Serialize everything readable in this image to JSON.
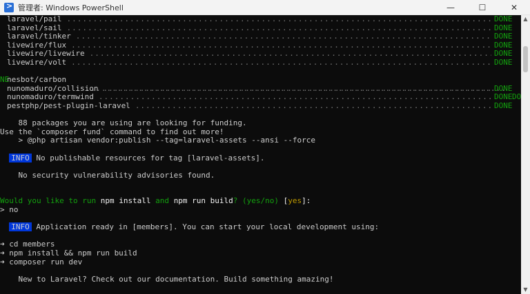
{
  "window": {
    "title": "管理者: Windows PowerShell",
    "minimize": "—",
    "maximize": "☐",
    "close": "✕"
  },
  "scrollbar": {
    "up": "▲",
    "down": "▼"
  },
  "packages": [
    {
      "name": "laravel/pail",
      "status": "DONE"
    },
    {
      "name": "laravel/sail",
      "status": "DONE"
    },
    {
      "name": "laravel/tinker",
      "status": "DONE"
    },
    {
      "name": "livewire/flux",
      "status": "DONE"
    },
    {
      "name": "livewire/livewire",
      "status": "DONE"
    },
    {
      "name": "livewire/volt",
      "status": "DONE"
    }
  ],
  "nesbot": {
    "name": "nesbot/carbon",
    "status_a": "DO",
    "status_b": "NE"
  },
  "packages2": [
    {
      "name": "nunomaduro/collision",
      "status": "DONE"
    },
    {
      "name": "nunomaduro/termwind",
      "status": "DONE"
    },
    {
      "name": "pestphp/pest-plugin-laravel",
      "status": "DONE"
    }
  ],
  "funding": {
    "line1": "    88 packages you are using are looking for funding.",
    "line2": "Use the `composer fund` command to find out more!",
    "line3": "    > @php artisan vendor:publish --tag=laravel-assets --ansi --force"
  },
  "info1": {
    "badge": "INFO",
    "text": " No publishable resources for tag [laravel-assets]."
  },
  "security": "    No security vulnerability advisories found.",
  "question": {
    "p1": "Would you like to run ",
    "cmd1": "npm install",
    "p2": " and ",
    "cmd2": "npm run build",
    "p3": "? (yes/no) ",
    "b_open": "[",
    "default": "yes",
    "b_close": "]:"
  },
  "answer": "> no",
  "info2": {
    "badge": "INFO",
    "text": " Application ready in [members]. You can start your local development using:"
  },
  "steps": [
    "➜ cd members",
    "➜ npm install && npm run build",
    "➜ composer run dev"
  ],
  "closing": "    New to Laravel? Check out our documentation. Build something amazing!"
}
